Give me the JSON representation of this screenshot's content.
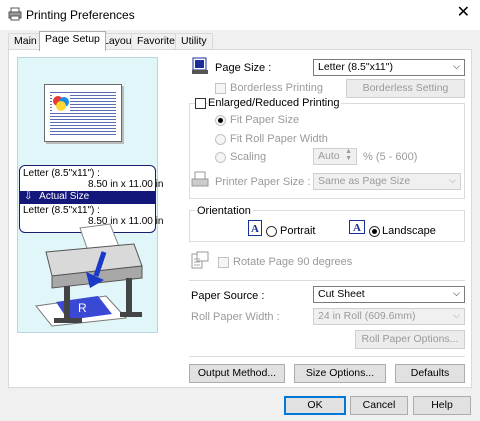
{
  "window": {
    "title": "Printing Preferences",
    "close_glyph": "✕"
  },
  "tabs": [
    {
      "label": "Main"
    },
    {
      "label": "Page Setup"
    },
    {
      "label": "Layout"
    },
    {
      "label": "Favorites"
    },
    {
      "label": "Utility"
    }
  ],
  "preview": {
    "paper_line1": "Letter (8.5\"x11\") :",
    "paper_line2": "8.50 in x 11.00 in",
    "actual_size": "Actual Size",
    "output_line1": "Letter (8.5\"x11\") :",
    "output_line2": "8.50 in x 11.00 in"
  },
  "page_size": {
    "label": "Page Size :",
    "value": "Letter (8.5\"x11\")"
  },
  "borderless": {
    "label": "Borderless Printing",
    "button": "Borderless Setting"
  },
  "enlarged": {
    "label": "Enlarged/Reduced Printing",
    "fit_paper": "Fit Paper Size",
    "fit_roll": "Fit Roll Paper Width",
    "scaling": "Scaling",
    "scaling_value": "Auto",
    "scaling_unit": "% (5 - 600)",
    "printer_paper_label": "Printer Paper Size :",
    "printer_paper_value": "Same as Page Size"
  },
  "orientation": {
    "label": "Orientation",
    "portrait": "Portrait",
    "landscape": "Landscape"
  },
  "rotate": {
    "label": "Rotate Page 90 degrees"
  },
  "paper_source": {
    "label": "Paper Source :",
    "value": "Cut Sheet"
  },
  "roll_width": {
    "label": "Roll Paper Width :",
    "value": "24 in Roll (609.6mm)",
    "button": "Roll Paper Options..."
  },
  "buttons": {
    "output_method": "Output Method...",
    "size_options": "Size Options...",
    "defaults": "Defaults",
    "ok": "OK",
    "cancel": "Cancel",
    "help": "Help"
  },
  "colors": {
    "accent": "#0078d7",
    "preview_bg": "#e0f6f8",
    "size_bar": "#14177a"
  }
}
